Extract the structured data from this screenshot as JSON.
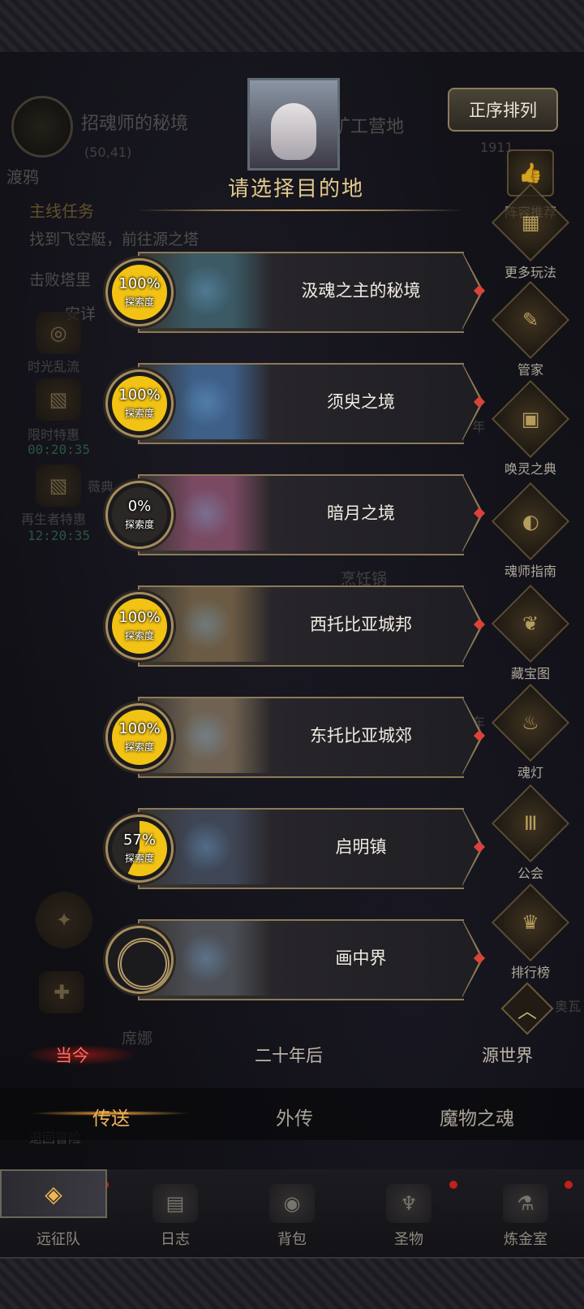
{
  "hud": {
    "location_name": "招魂师的秘境",
    "coords": "(50,41)",
    "player": "渡鸦",
    "camp": "矿工营地",
    "currency": "1911",
    "quest_header": "主线任务",
    "quest_1": "找到飞空艇，前往源之塔",
    "quest_2": "击败塔里",
    "quest_3": "安详",
    "time_flow": "时光乱流",
    "limited_sale": "限时特惠",
    "limited_timer": "00:20:35",
    "reborn_sale": "再生者特惠",
    "reborn_timer": "12:20:35",
    "reborn_extra": "薇典",
    "cooking_pot": "烹饪锅",
    "npc_name": "席娜",
    "side_fragment_1": "年",
    "side_fragment_2": "车",
    "side_fragment_3": "奥瓦",
    "back_fragment": "退回冒险"
  },
  "sidebar": {
    "sort_button": "正序排列",
    "items": [
      {
        "label": "阵容推荐",
        "icon": "👍"
      },
      {
        "label": "更多玩法",
        "icon": "▦"
      },
      {
        "label": "管家",
        "icon": "✎"
      },
      {
        "label": "唤灵之典",
        "icon": "▣"
      },
      {
        "label": "魂师指南",
        "icon": "◐"
      },
      {
        "label": "藏宝图",
        "icon": "❦"
      },
      {
        "label": "魂灯",
        "icon": "♨"
      },
      {
        "label": "公会",
        "icon": "Ⅲ"
      },
      {
        "label": "排行榜",
        "icon": "♛"
      }
    ],
    "up_arrow": "︿"
  },
  "panel": {
    "title": "请选择目的地",
    "explore_caption": "探索度",
    "destinations": [
      {
        "name": "汲魂之主的秘境",
        "progress": "100%",
        "value": 1.0,
        "art": "#3b5a66"
      },
      {
        "name": "须臾之境",
        "progress": "100%",
        "value": 1.0,
        "art": "#3d5f88"
      },
      {
        "name": "暗月之境",
        "progress": "0%",
        "value": 0.0,
        "art": "#7a4a63"
      },
      {
        "name": "西托比亚城邦",
        "progress": "100%",
        "value": 1.0,
        "art": "#6b5b44"
      },
      {
        "name": "东托比亚城郊",
        "progress": "100%",
        "value": 1.0,
        "art": "#6f6252"
      },
      {
        "name": "启明镇",
        "progress": "57%",
        "value": 0.57,
        "art": "#3e4656"
      },
      {
        "name": "画中界",
        "progress": "",
        "value": null,
        "art": "#4c4f56"
      }
    ]
  },
  "era_tabs": [
    "当今",
    "二十年后",
    "源世界"
  ],
  "lower_tabs": [
    "传送",
    "外传",
    "魔物之魂"
  ],
  "nav": [
    {
      "label": "远征队",
      "icon": "◈"
    },
    {
      "label": "日志",
      "icon": "▤"
    },
    {
      "label": "背包",
      "icon": "◉"
    },
    {
      "label": "圣物",
      "icon": "♆"
    },
    {
      "label": "炼金室",
      "icon": "⚗"
    }
  ],
  "colors": {
    "accent_gold": "#e2c98b",
    "active_red": "#ff6b62",
    "active_orange": "#f0b35a",
    "progress_yellow": "#f2c314",
    "badge_red": "#c0201b"
  }
}
